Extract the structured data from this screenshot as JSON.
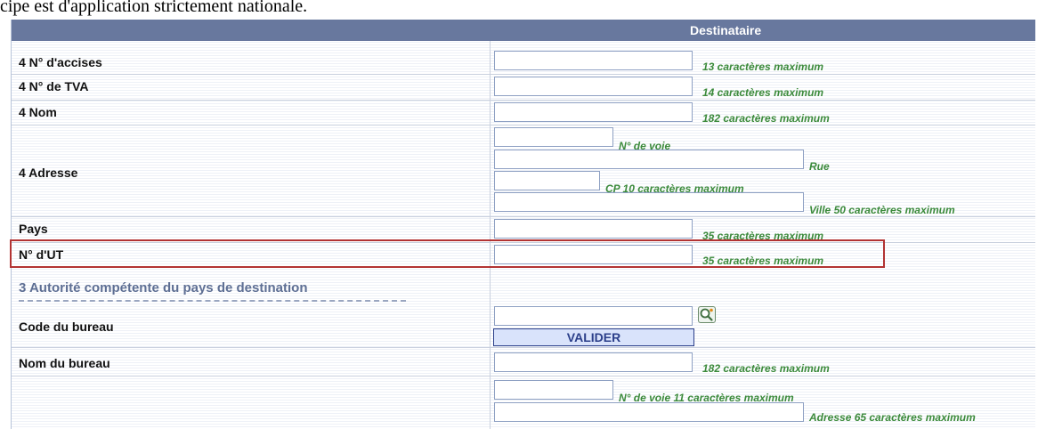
{
  "top_text": "cipe est d'application strictement nationale.",
  "header": {
    "title": "Destinataire"
  },
  "rows": {
    "accises": {
      "label": "4 N° d'accises",
      "hint": "13 caractères maximum"
    },
    "tva": {
      "label": "4 N° de TVA",
      "hint": "14 caractères maximum"
    },
    "nom": {
      "label": "4 Nom",
      "hint": "182 caractères maximum"
    },
    "adresse": {
      "label": "4 Adresse",
      "hint_voie": "N° de voie",
      "hint_rue": "Rue",
      "hint_cp": "CP 10 caractères maximum",
      "hint_ville": "Ville 50 caractères maximum"
    },
    "pays": {
      "label": "Pays",
      "hint": "35 caractères maximum"
    },
    "ut": {
      "label": "N° d'UT",
      "hint": "35 caractères maximum"
    }
  },
  "section": {
    "title": "3 Autorité compétente du pays de destination"
  },
  "bureau": {
    "code_label": "Code du bureau",
    "valider_label": "VALIDER",
    "search_icon": "search-icon",
    "nom_label": "Nom du bureau",
    "nom_hint": "182 caractères maximum",
    "voie_hint": "N° de voie 11 caractères maximum",
    "adresse_hint": "Adresse 65 caractères maximum"
  },
  "colors": {
    "header_bg": "#68789e",
    "hint_green": "#3b8a3b",
    "highlight_red": "#b23333"
  }
}
